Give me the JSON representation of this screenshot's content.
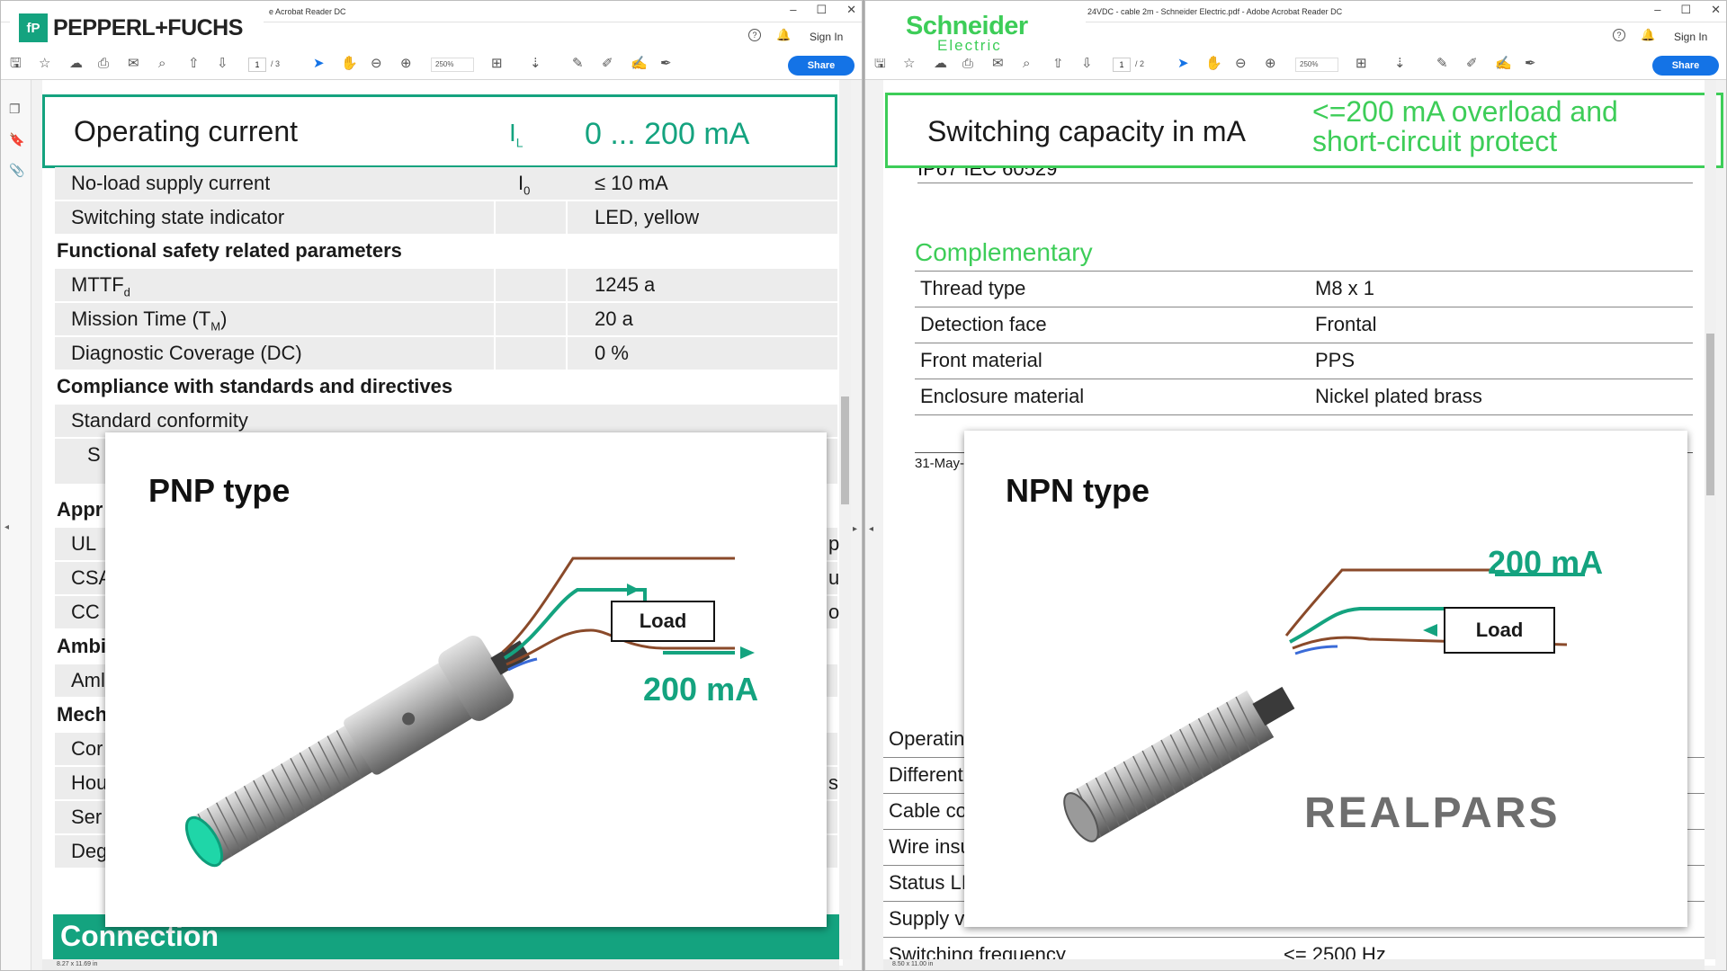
{
  "left": {
    "title": "e Acrobat Reader DC",
    "logo_text": "PEPPERL+FUCHS",
    "logo_mark": "fP",
    "menu": {
      "help": "?",
      "sign_in": "Sign In"
    },
    "toolbar": {
      "page": "1",
      "pages": "/ 3",
      "zoom": "250%",
      "share": "Share"
    },
    "highlight": {
      "label": "Operating current",
      "symbol": "I",
      "symbol_sub": "L",
      "value": "0 ... 200 mA"
    },
    "rows": [
      {
        "label": "No-load supply current",
        "symbol": "I",
        "symbol_sub": "0",
        "value": "≤ 10 mA"
      },
      {
        "label": "Switching state indicator",
        "symbol": "",
        "symbol_sub": "",
        "value": "LED, yellow"
      }
    ],
    "section_safety": "Functional safety related parameters",
    "safety_rows": [
      {
        "label": "MTTF",
        "label_sub": "d",
        "label_tail": "",
        "value": "1245 a"
      },
      {
        "label": "Mission Time (T",
        "label_sub": "M",
        "label_tail": ")",
        "value": "20 a"
      },
      {
        "label": "Diagnostic Coverage (DC)",
        "label_sub": "",
        "label_tail": "",
        "value": "0 %"
      }
    ],
    "section_compliance": "Compliance with standards and directives",
    "standard_conformity": "Standard conformity",
    "standard_s": "S",
    "partial_sections": [
      "Appr",
      "Ambi",
      "Mech"
    ],
    "partial_rows": [
      "UL ",
      "CSA",
      "CC",
      "Aml",
      "Cor",
      "Hou",
      "Ser",
      "Deg"
    ],
    "partial_right": [
      "pc",
      "ur",
      "ot",
      "si"
    ],
    "connection": "Connection",
    "page_size": "8.27 x 11.69 in",
    "slide": {
      "title": "PNP type",
      "load": "Load",
      "current": "200 mA"
    }
  },
  "right": {
    "title": "24VDC - cable 2m - Schneider Electric.pdf - Adobe Acrobat Reader DC",
    "logo_line1": "Schneider",
    "logo_line2": "Electric",
    "menu": {
      "help": "?",
      "sign_in": "Sign In"
    },
    "toolbar": {
      "page": "1",
      "pages": "/ 2",
      "zoom": "250%",
      "share": "Share"
    },
    "highlight": {
      "label": "Switching capacity in mA",
      "value_line1": "<=200 mA overload and",
      "value_line2": "short-circuit protect"
    },
    "cut_text": "IP67 IEC 60529",
    "section": "Complementary",
    "rows": [
      {
        "label": "Thread type",
        "value": "M8 x 1"
      },
      {
        "label": "Detection face",
        "value": "Frontal"
      },
      {
        "label": "Front material",
        "value": "PPS"
      },
      {
        "label": "Enclosure material",
        "value": "Nickel plated brass"
      }
    ],
    "date_fragment": "31-May-",
    "partial_rows": [
      "Operatin",
      "Different",
      "Cable co",
      "Wire insu",
      "Status LI",
      "Supply v"
    ],
    "last_row": {
      "label": "Switching frequency",
      "value": "<= 2500 Hz"
    },
    "page_size": "8.50 x 11.00 in",
    "slide": {
      "title": "NPN type",
      "load": "Load",
      "current": "200 mA",
      "watermark": "REALPARS"
    }
  }
}
